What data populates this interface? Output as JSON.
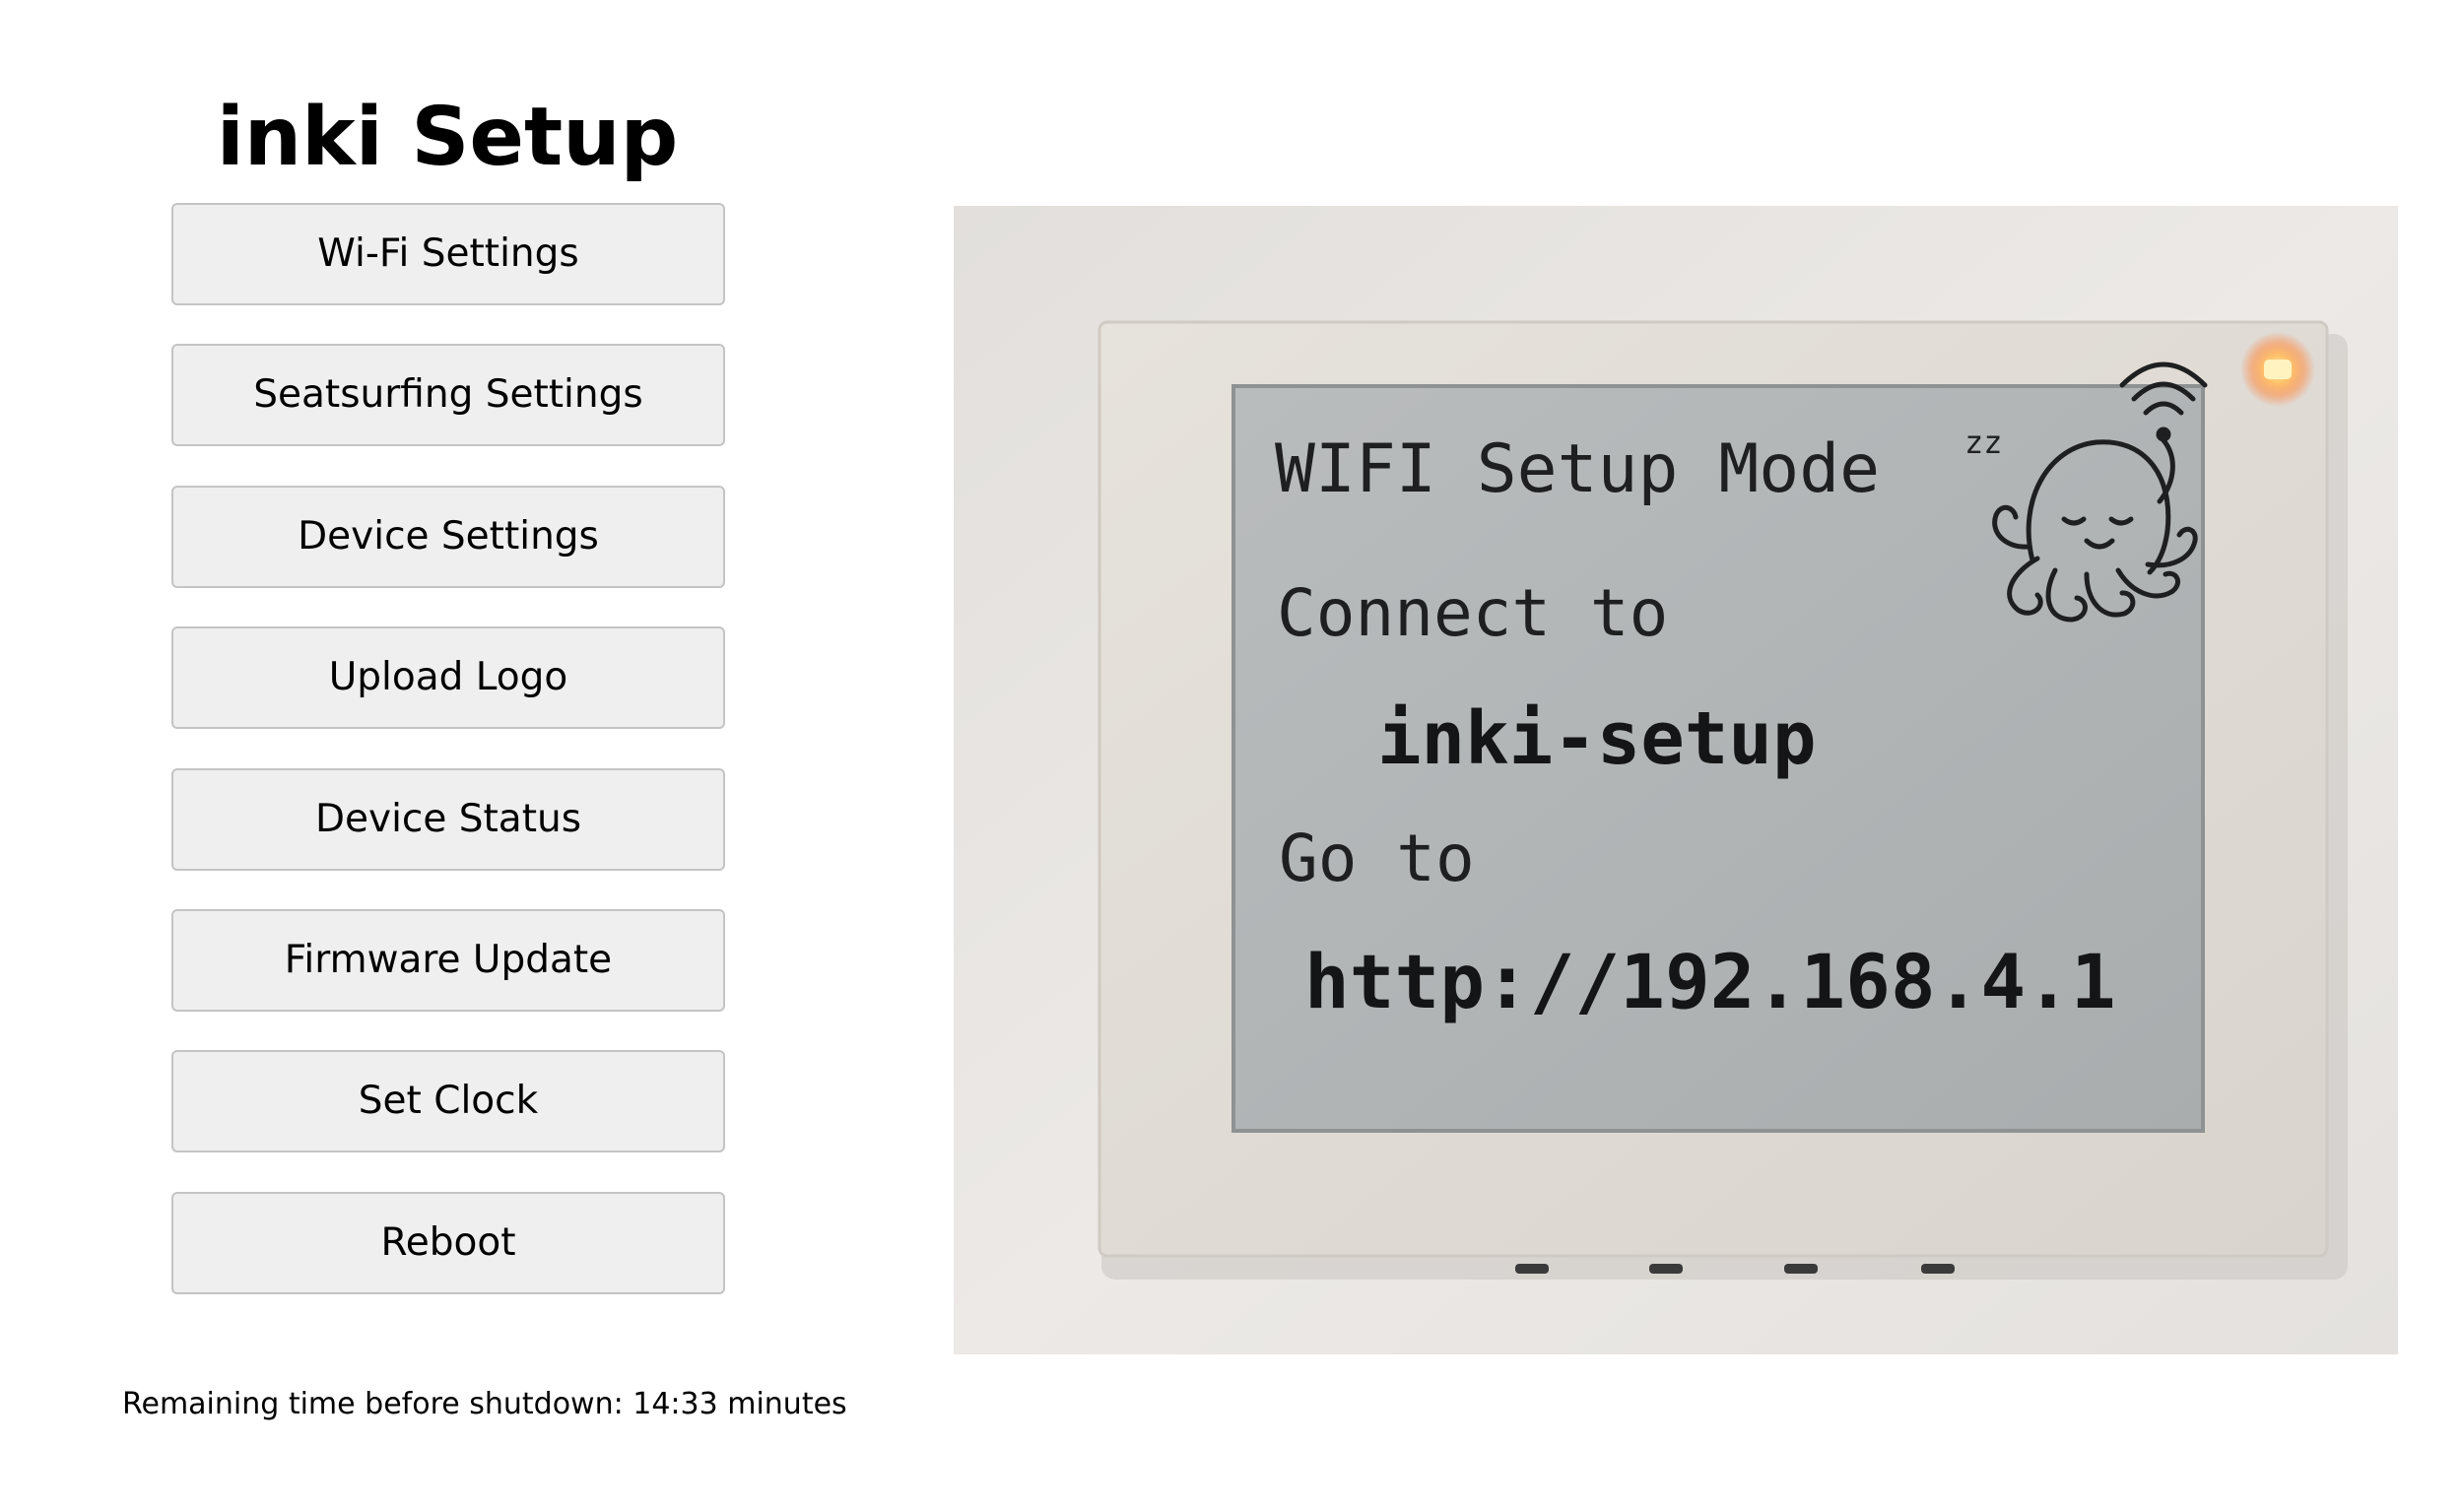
{
  "page": {
    "title": "inki Setup"
  },
  "menu": {
    "items": [
      {
        "label": "Wi-Fi Settings"
      },
      {
        "label": "Seatsurfing Settings"
      },
      {
        "label": "Device Settings"
      },
      {
        "label": "Upload Logo"
      },
      {
        "label": "Device Status"
      },
      {
        "label": "Firmware Update"
      },
      {
        "label": "Set Clock"
      },
      {
        "label": "Reboot"
      }
    ]
  },
  "status": {
    "remaining_text": "Remaining time before shutdown: 14:33 minutes"
  },
  "device_photo": {
    "screen_lines": {
      "mode": "WIFI Setup Mode",
      "connect_to": "Connect to",
      "ssid": "inki-setup",
      "go_to": "Go to",
      "url": "http://192.168.4.1"
    },
    "sleep_mark": "zz",
    "mascot_icon": "octopus-icon",
    "led_color": "#ff9d45"
  }
}
